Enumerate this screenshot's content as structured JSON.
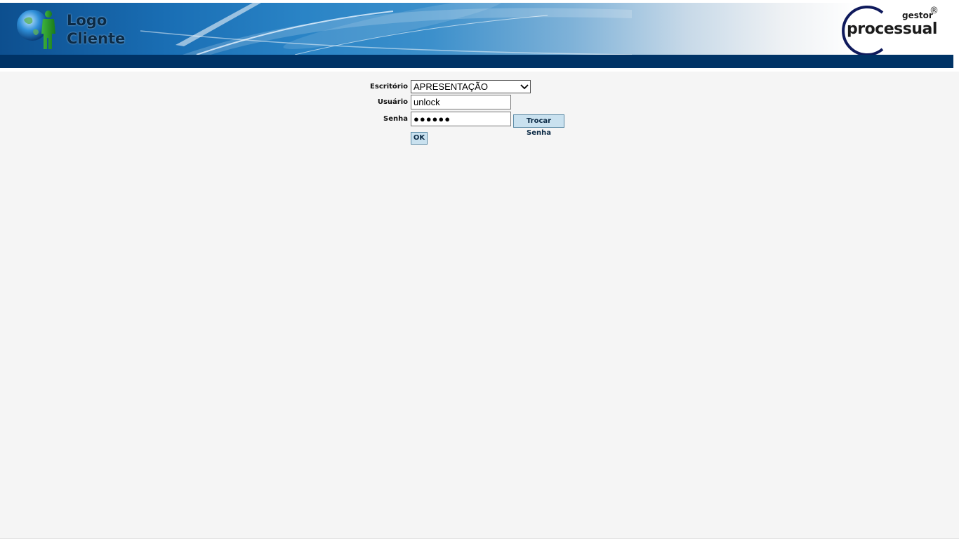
{
  "header": {
    "client_logo": {
      "line1": "Logo",
      "line2": "Cliente"
    },
    "brand_logo": {
      "prefix": "gestor",
      "registered": "®",
      "name": "processual"
    },
    "colors": {
      "navbar": "#003366",
      "banner_start": "#0d4f8f",
      "banner_end": "#ffffff"
    }
  },
  "login_form": {
    "office_label": "Escritório",
    "office_selected": "APRESENTAÇÃO",
    "username_label": "Usuário",
    "username_value": "unlock",
    "password_label": "Senha",
    "password_value": "●●●●●●",
    "change_password_label": "Trocar Senha",
    "ok_label": "OK",
    "colors": {
      "content_bg": "#f5f5f5",
      "button_bg": "#c9e1ef"
    }
  }
}
